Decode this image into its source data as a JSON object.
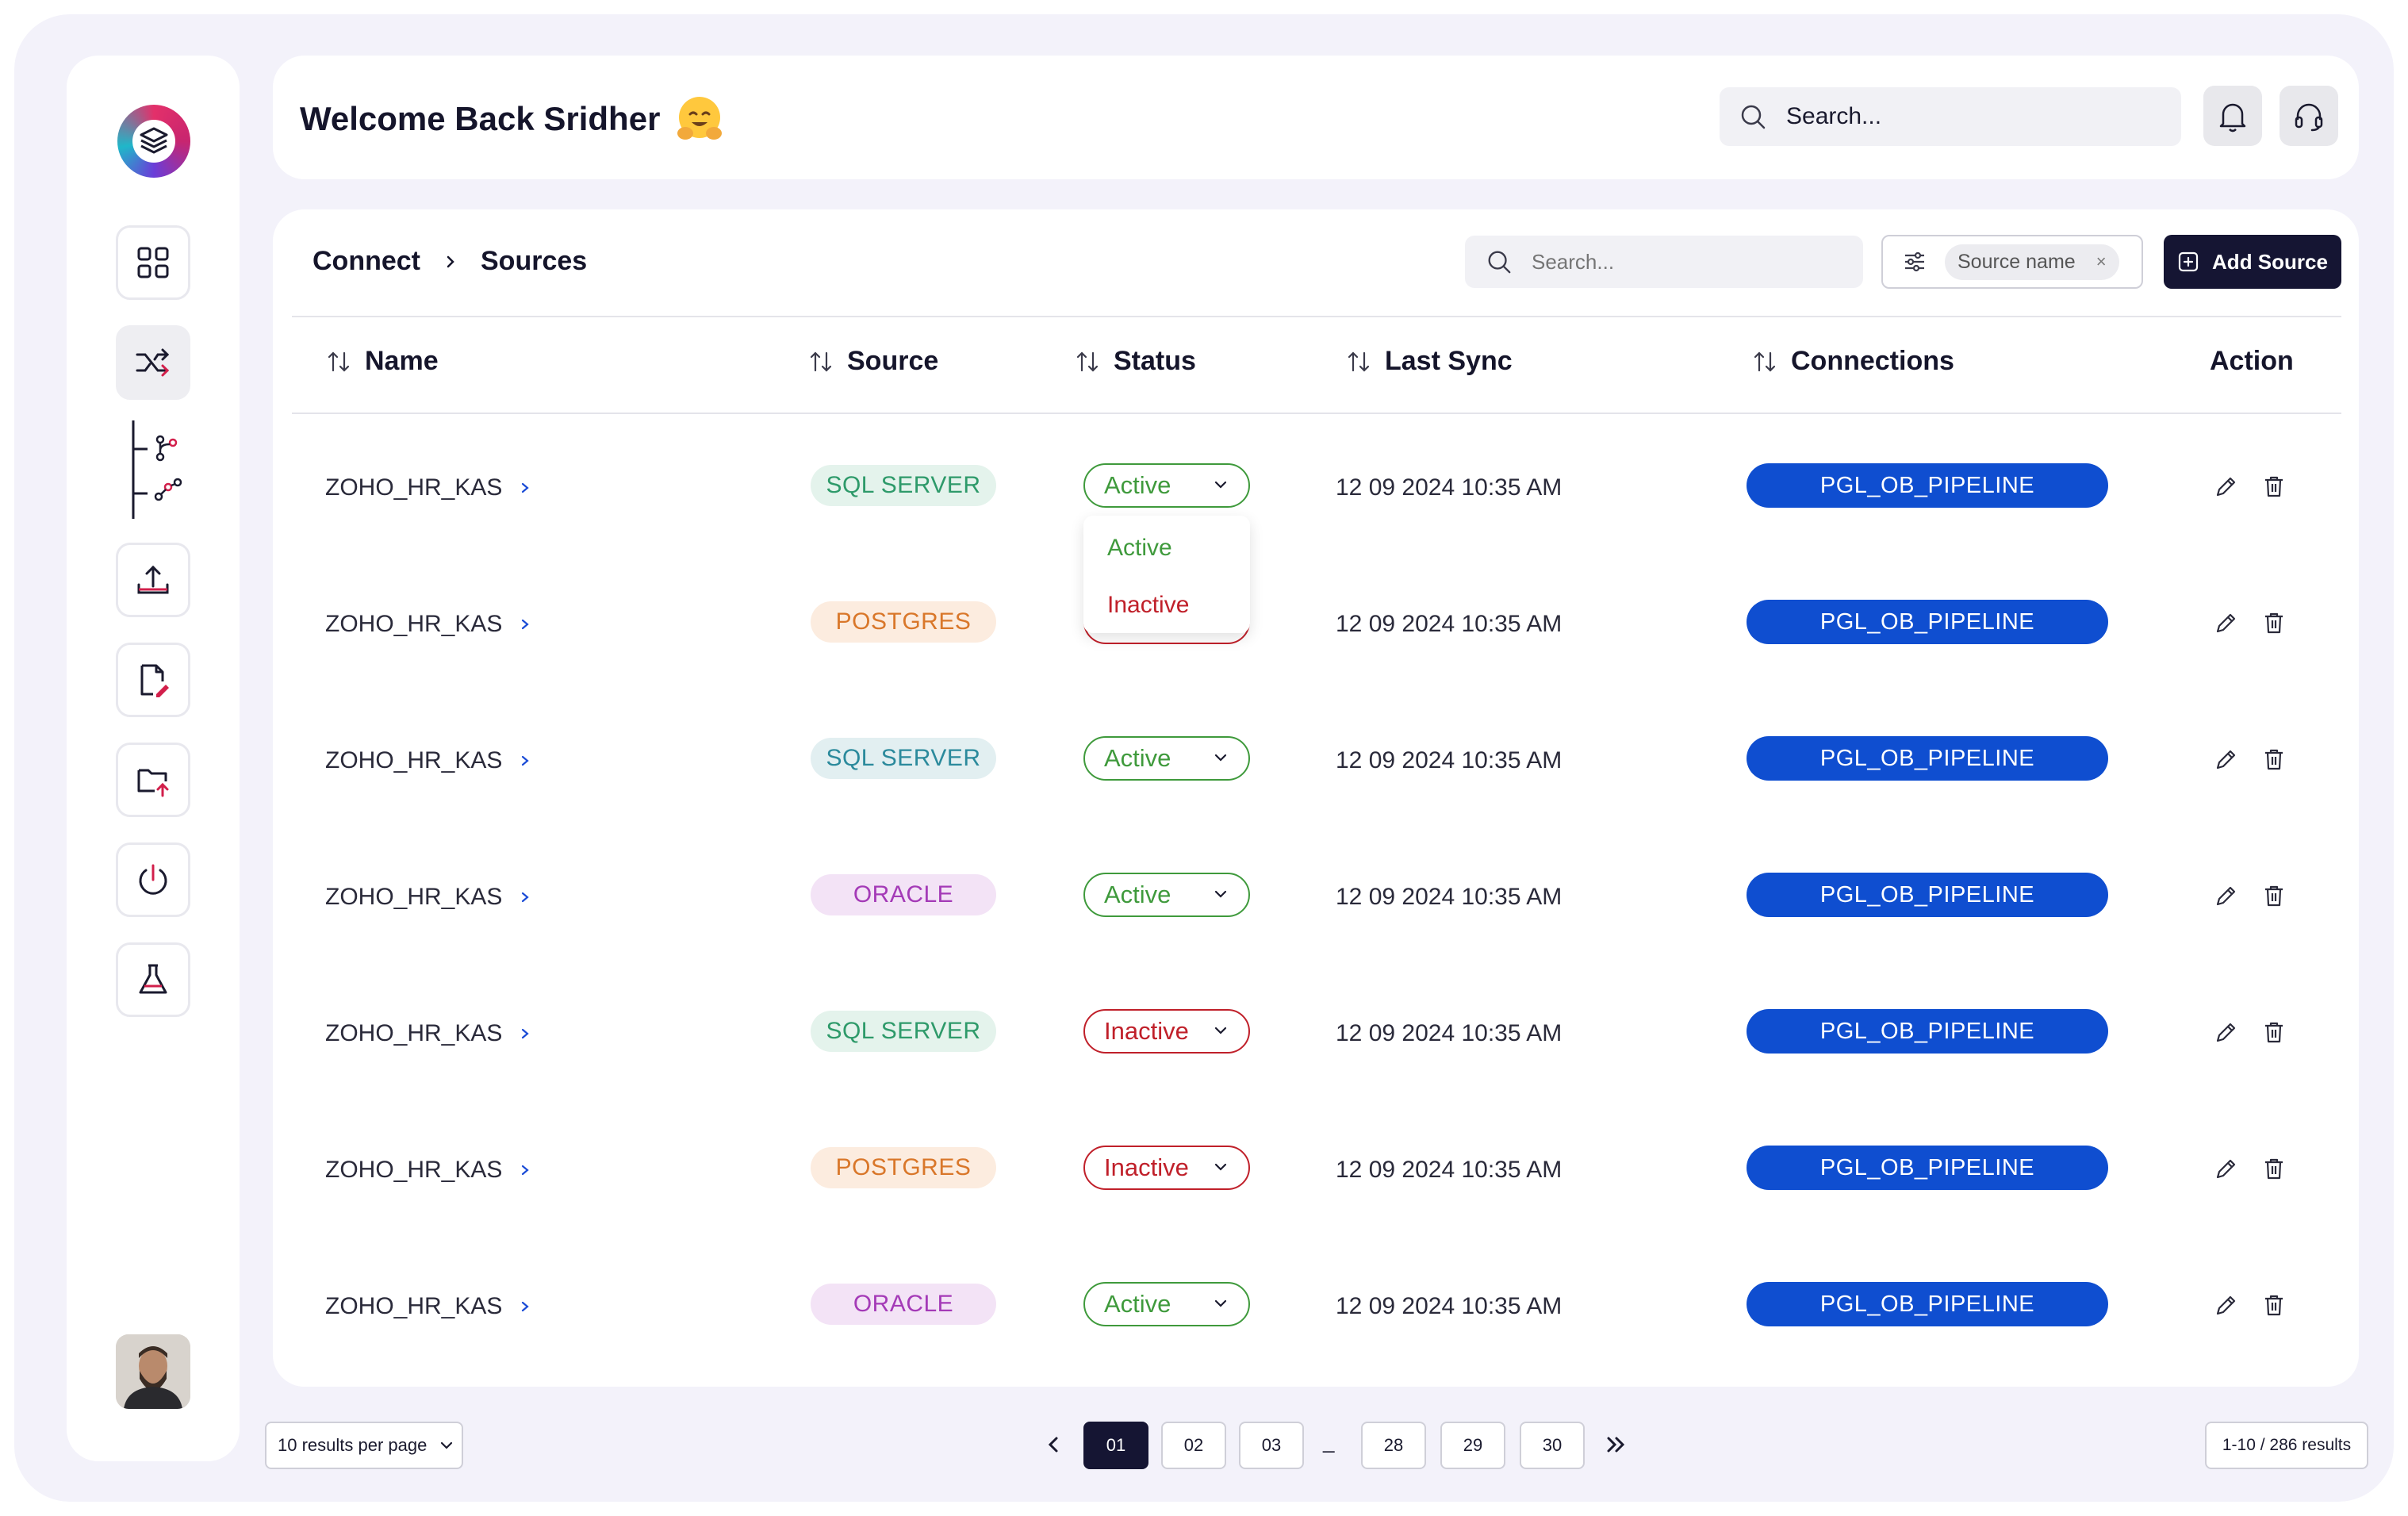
{
  "header": {
    "welcome": "Welcome Back Sridher",
    "search_placeholder": "Search...",
    "emoji": "hugging-face-emoji"
  },
  "breadcrumb": {
    "parent": "Connect",
    "current": "Sources"
  },
  "toolbar": {
    "search_placeholder": "Search...",
    "filter_chip": "Source name",
    "filter_chip_close": "×",
    "add_source_label": "Add Source"
  },
  "table": {
    "headers": {
      "name": "Name",
      "source": "Source",
      "status": "Status",
      "last_sync": "Last Sync",
      "connections": "Connections",
      "action": "Action"
    },
    "rows": [
      {
        "name": "ZOHO_HR_KAS",
        "source": "SQL SERVER",
        "source_kind": "green",
        "status": "Active",
        "last_sync": "12 09 2024 10:35 AM",
        "connection": "PGL_OB_PIPELINE"
      },
      {
        "name": "ZOHO_HR_KAS",
        "source": "POSTGRES",
        "source_kind": "orange",
        "status": "Inactive",
        "last_sync": "12 09 2024 10:35 AM",
        "connection": "PGL_OB_PIPELINE"
      },
      {
        "name": "ZOHO_HR_KAS",
        "source": "SQL SERVER",
        "source_kind": "teal",
        "status": "Active",
        "last_sync": "12 09 2024 10:35 AM",
        "connection": "PGL_OB_PIPELINE"
      },
      {
        "name": "ZOHO_HR_KAS",
        "source": "ORACLE",
        "source_kind": "purple",
        "status": "Active",
        "last_sync": "12 09 2024 10:35 AM",
        "connection": "PGL_OB_PIPELINE"
      },
      {
        "name": "ZOHO_HR_KAS",
        "source": "SQL SERVER",
        "source_kind": "green",
        "status": "Inactive",
        "last_sync": "12 09 2024 10:35 AM",
        "connection": "PGL_OB_PIPELINE"
      },
      {
        "name": "ZOHO_HR_KAS",
        "source": "POSTGRES",
        "source_kind": "orange",
        "status": "Inactive",
        "last_sync": "12 09 2024 10:35 AM",
        "connection": "PGL_OB_PIPELINE"
      },
      {
        "name": "ZOHO_HR_KAS",
        "source": "ORACLE",
        "source_kind": "purple",
        "status": "Active",
        "last_sync": "12 09 2024 10:35 AM",
        "connection": "PGL_OB_PIPELINE"
      }
    ]
  },
  "status_dropdown": {
    "options": [
      "Active",
      "Inactive"
    ]
  },
  "pagination": {
    "per_page": "10 results per page",
    "pages": [
      "01",
      "02",
      "03",
      "28",
      "29",
      "30"
    ],
    "current": "01",
    "ellipsis": "_",
    "results": "1-10 / 286 results"
  },
  "colors": {
    "active": "#3f9a3c",
    "inactive": "#c0202a",
    "connection": "#0f4ed0",
    "primary_dark": "#151533",
    "badge_green_bg": "#e4f3ec",
    "badge_green_fg": "#2e9a6a",
    "badge_orange_bg": "#fcecdf",
    "badge_orange_fg": "#d9772a",
    "badge_teal_bg": "#e2eff1",
    "badge_teal_fg": "#2b8a9c",
    "badge_purple_bg": "#f3e3f6",
    "badge_purple_fg": "#a43ab7"
  },
  "icons": [
    "logo-icon",
    "grid-icon",
    "shuffle-icon",
    "branch-icon",
    "graph-icon",
    "upload-icon",
    "file-edit-icon",
    "folder-upload-icon",
    "power-icon",
    "flask-icon",
    "bell-icon",
    "headset-icon",
    "search-icon",
    "sort-icon",
    "pencil-icon",
    "trash-icon",
    "filter-icon",
    "plus-square-icon",
    "chevron-left-icon",
    "double-chevron-right-icon"
  ]
}
